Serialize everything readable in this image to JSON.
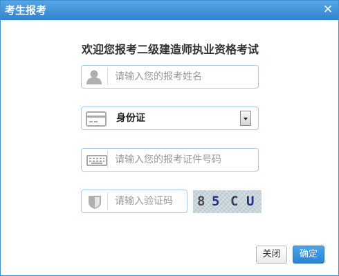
{
  "dialog": {
    "title": "考生报考",
    "close_glyph": "✕"
  },
  "heading": "欢迎您报考二级建造师执业资格考试",
  "form": {
    "name_placeholder": "请输入您的报考姓名",
    "id_type_value": "身份证",
    "id_number_placeholder": "请输入您的报考证件号码",
    "captcha_placeholder": "请输入验证码",
    "captcha_chars": [
      "8",
      "5",
      "C",
      "U"
    ]
  },
  "buttons": {
    "close_label": "关闭",
    "confirm_label": "确定"
  },
  "colors": {
    "titlebar": "#2f83cd",
    "input_border": "#a9c9e8",
    "confirm_button": "#2c84cf"
  },
  "icons": {
    "name": "user-icon",
    "id_type": "id-card-icon",
    "dropdown": "dropdown-arrow-icon",
    "id_number": "keyboard-icon",
    "captcha": "shield-icon"
  }
}
